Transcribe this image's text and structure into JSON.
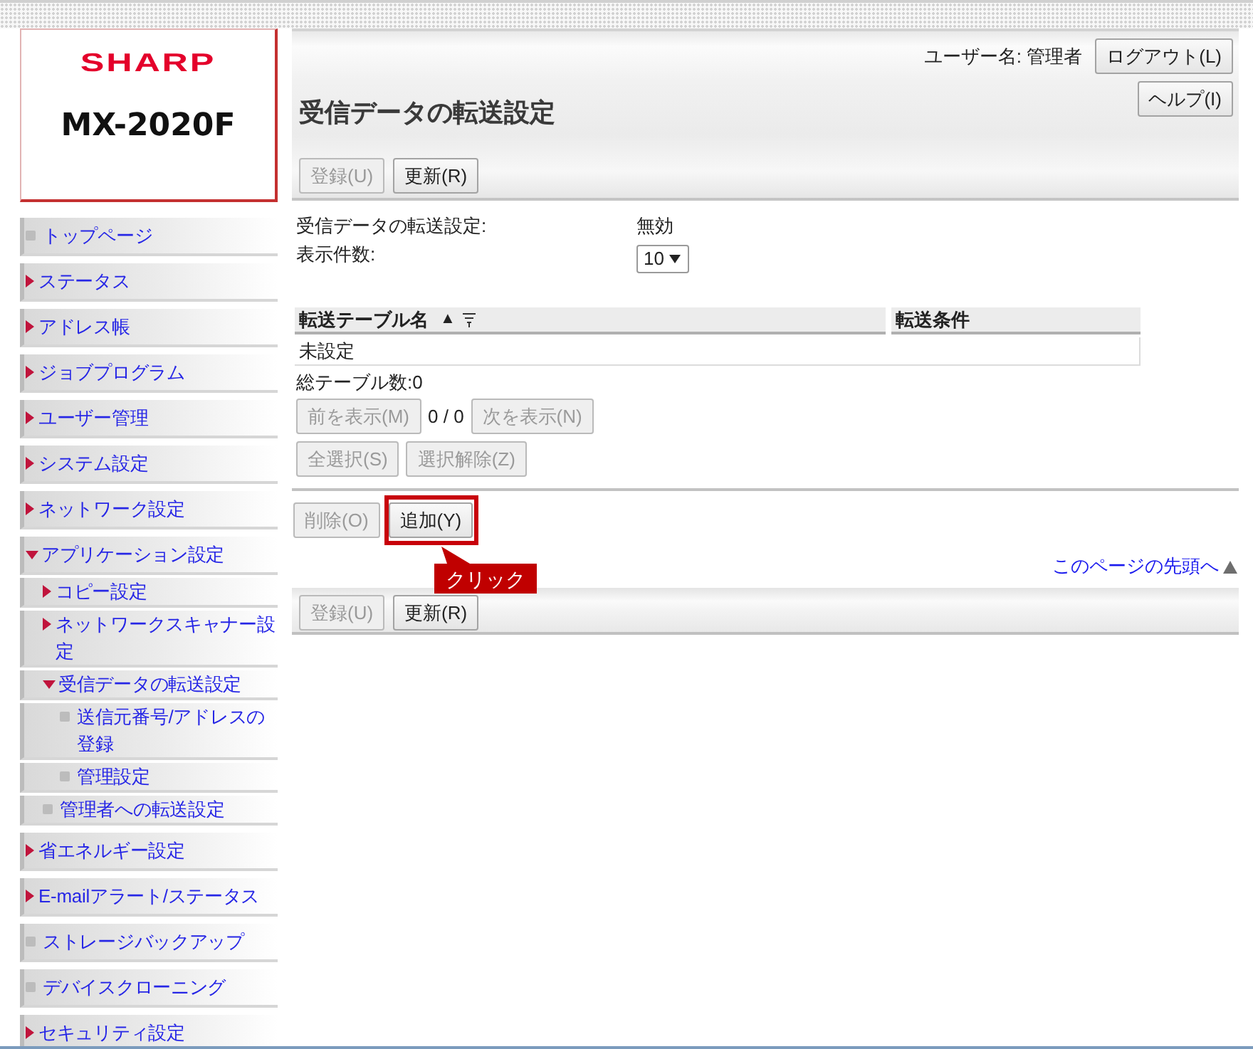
{
  "logo": {
    "brand": "SHARP",
    "model": "MX-2020F"
  },
  "header": {
    "user": "ユーザー名: 管理者",
    "logout": "ログアウト(L)",
    "help": "ヘルプ(I)",
    "title": "受信データの転送設定",
    "buttons": [
      {
        "label": "登録(U)",
        "disabled": true
      },
      {
        "label": "更新(R)",
        "disabled": false
      }
    ]
  },
  "sidebar": {
    "items": [
      {
        "label": "トップページ",
        "kind": "page"
      },
      {
        "label": "ステータス",
        "kind": "branch",
        "expanded": false
      },
      {
        "label": "アドレス帳",
        "kind": "branch",
        "expanded": false
      },
      {
        "label": "ジョブプログラム",
        "kind": "branch",
        "expanded": false
      },
      {
        "label": "ユーザー管理",
        "kind": "branch",
        "expanded": false
      },
      {
        "label": "システム設定",
        "kind": "branch",
        "expanded": false
      },
      {
        "label": "ネットワーク設定",
        "kind": "branch",
        "expanded": false
      },
      {
        "label": "アプリケーション設定",
        "kind": "branch",
        "expanded": true,
        "children": [
          {
            "label": "コピー設定",
            "kind": "branch",
            "expanded": false
          },
          {
            "label": "ネットワークスキャナー設定",
            "kind": "branch",
            "expanded": false
          },
          {
            "label": "受信データの転送設定",
            "kind": "branch",
            "expanded": true,
            "children": [
              {
                "label": "送信元番号/アドレスの登録",
                "kind": "page"
              },
              {
                "label": "管理設定",
                "kind": "page"
              }
            ]
          },
          {
            "label": "管理者への転送設定",
            "kind": "page"
          }
        ]
      },
      {
        "label": "省エネルギー設定",
        "kind": "branch",
        "expanded": false
      },
      {
        "label": "E-mailアラート/ステータス",
        "kind": "branch",
        "expanded": false
      },
      {
        "label": "ストレージバックアップ",
        "kind": "page"
      },
      {
        "label": "デバイスクローニング",
        "kind": "page"
      },
      {
        "label": "セキュリティ設定",
        "kind": "branch",
        "expanded": false
      }
    ]
  },
  "settings": [
    {
      "label": "受信データの転送設定:",
      "kind": "text",
      "value": "無効"
    },
    {
      "label": "表示件数:",
      "kind": "select",
      "value": "10"
    }
  ],
  "table": {
    "columns": [
      {
        "label": "転送テーブル名",
        "sort_mark": "▲",
        "filter": true
      },
      {
        "label": "転送条件",
        "filter": false
      }
    ],
    "rows": [
      {
        "cells": [
          "未設定"
        ]
      }
    ]
  },
  "total": "総テーブル数:0",
  "pager": {
    "prev": {
      "label": "前を表示(M)",
      "disabled": true
    },
    "count": "0 / 0",
    "next": {
      "label": "次を表示(N)",
      "disabled": true
    }
  },
  "selection": {
    "buttons": [
      {
        "label": "全選択(S)",
        "disabled": true
      },
      {
        "label": "選択解除(Z)",
        "disabled": true
      }
    ]
  },
  "actions": {
    "buttons": [
      {
        "label": "削除(O)",
        "disabled": true,
        "highlighted": false
      },
      {
        "label": "追加(Y)",
        "disabled": false,
        "highlighted": true
      }
    ]
  },
  "annotation": {
    "text": "クリック"
  },
  "top_link": {
    "label": "このページの先頭へ"
  },
  "footer": {
    "buttons": [
      {
        "label": "登録(U)",
        "disabled": true
      },
      {
        "label": "更新(R)",
        "disabled": false
      }
    ]
  }
}
